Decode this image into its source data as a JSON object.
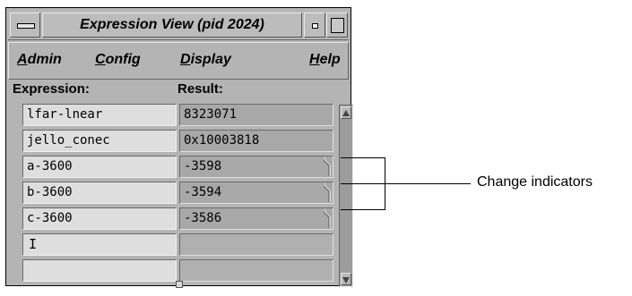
{
  "window": {
    "title": "Expression View (pid 2024)"
  },
  "menu": [
    {
      "label": "Admin",
      "mnemonic": "A"
    },
    {
      "label": "Config",
      "mnemonic": "C"
    },
    {
      "label": "Display",
      "mnemonic": "D"
    },
    {
      "label": "Help",
      "mnemonic": "H"
    }
  ],
  "columns": {
    "expression": "Expression:",
    "result": "Result:"
  },
  "rows": [
    {
      "expression": "lfar-lnear",
      "result": "8323071",
      "changed": false
    },
    {
      "expression": "jello_conec",
      "result": "0x10003818",
      "changed": false
    },
    {
      "expression": "a-3600",
      "result": "-3598",
      "changed": true
    },
    {
      "expression": "b-3600",
      "result": "-3594",
      "changed": true
    },
    {
      "expression": "c-3600",
      "result": "-3586",
      "changed": true
    },
    {
      "expression": "",
      "result": "",
      "changed": false
    },
    {
      "expression": "",
      "result": "",
      "changed": false
    }
  ],
  "annotation": {
    "label": "Change indicators"
  },
  "icons": {
    "window_menu": "window-menu-icon",
    "minimize": "minimize-icon",
    "maximize": "maximize-icon",
    "scroll_up": "scroll-up-arrow-icon",
    "scroll_down": "scroll-down-arrow-icon",
    "text_cursor": "text-cursor-icon",
    "change_indicator": "change-indicator-icon"
  }
}
